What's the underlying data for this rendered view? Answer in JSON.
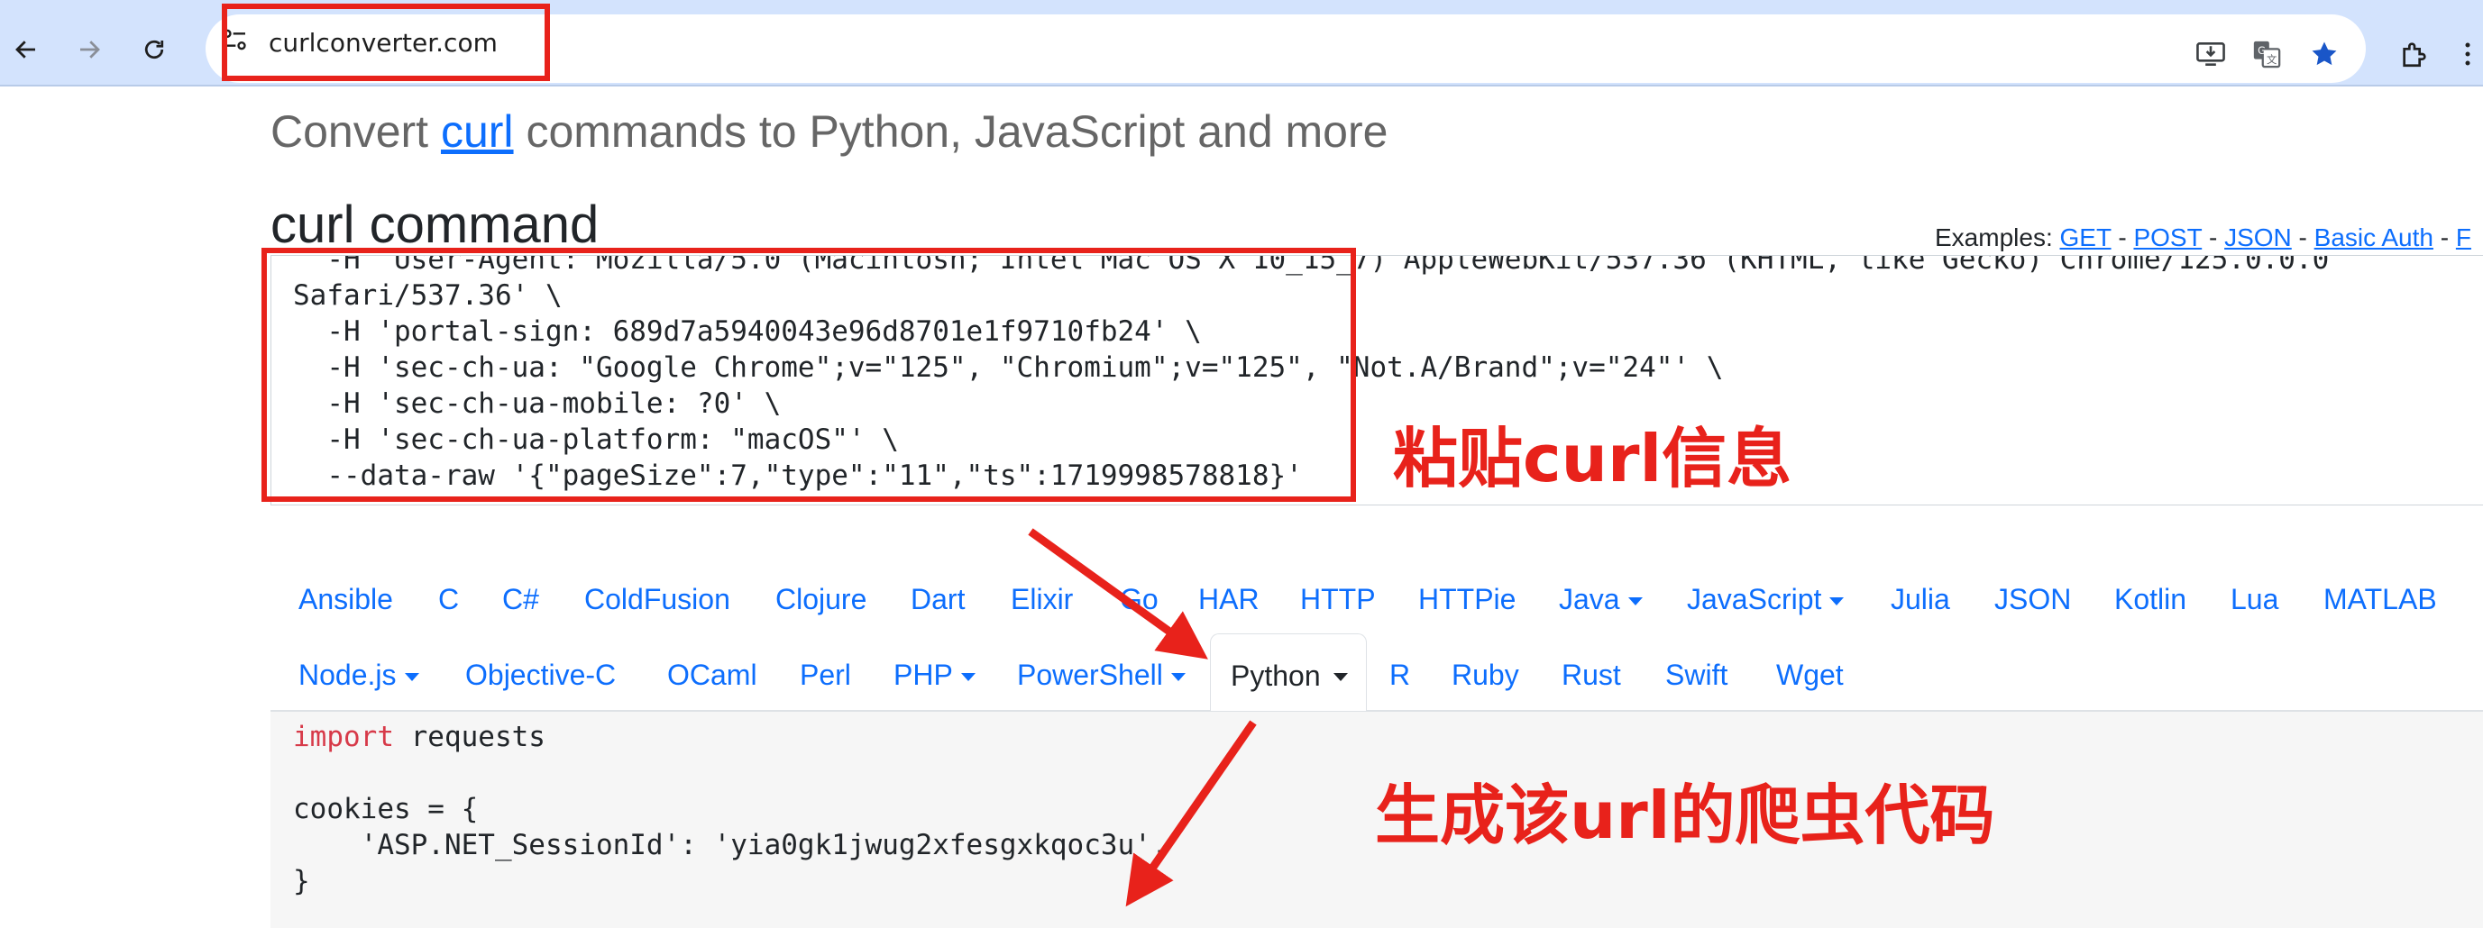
{
  "browser": {
    "url": "curlconverter.com",
    "icons": {
      "back": "back-arrow-icon",
      "forward": "forward-arrow-icon",
      "reload": "reload-icon",
      "site_info": "tune-icon",
      "install": "install-app-icon",
      "translate": "translate-icon",
      "bookmark": "star-icon",
      "extensions": "puzzle-icon"
    }
  },
  "page": {
    "title_prefix": "Convert ",
    "title_link": "curl",
    "title_suffix": " commands to Python, JavaScript and more",
    "curl_heading": "curl command",
    "examples_label": "Examples: ",
    "examples": [
      "GET",
      "POST",
      "JSON",
      "Basic Auth",
      "F"
    ],
    "examples_separator": " - "
  },
  "curl_input": {
    "lines": [
      "  -H 'User-Agent: Mozilla/5.0 (Macintosh; Intel Mac OS X 10_15_7) AppleWebKit/537.36 (KHTML, like Gecko) Chrome/125.0.0.0",
      "Safari/537.36' \\",
      "  -H 'portal-sign: 689d7a5940043e96d8701e1f9710fb24' \\",
      "  -H 'sec-ch-ua: \"Google Chrome\";v=\"125\", \"Chromium\";v=\"125\", \"Not.A/Brand\";v=\"24\"' \\",
      "  -H 'sec-ch-ua-mobile: ?0' \\",
      "  -H 'sec-ch-ua-platform: \"macOS\"' \\",
      "  --data-raw '{\"pageSize\":7,\"type\":\"11\",\"ts\":1719998578818}'"
    ]
  },
  "languages": {
    "row1": [
      {
        "label": "Ansible",
        "dropdown": false
      },
      {
        "label": "C",
        "dropdown": false
      },
      {
        "label": "C#",
        "dropdown": false
      },
      {
        "label": "ColdFusion",
        "dropdown": false
      },
      {
        "label": "Clojure",
        "dropdown": false
      },
      {
        "label": "Dart",
        "dropdown": false
      },
      {
        "label": "Elixir",
        "dropdown": false
      },
      {
        "label": "Go",
        "dropdown": false
      },
      {
        "label": "HAR",
        "dropdown": false
      },
      {
        "label": "HTTP",
        "dropdown": false
      },
      {
        "label": "HTTPie",
        "dropdown": false
      },
      {
        "label": "Java",
        "dropdown": true
      },
      {
        "label": "JavaScript",
        "dropdown": true
      },
      {
        "label": "Julia",
        "dropdown": false
      },
      {
        "label": "JSON",
        "dropdown": false
      },
      {
        "label": "Kotlin",
        "dropdown": false
      },
      {
        "label": "Lua",
        "dropdown": false
      },
      {
        "label": "MATLAB",
        "dropdown": false
      }
    ],
    "row2": [
      {
        "label": "Node.js",
        "dropdown": true
      },
      {
        "label": "Objective-C",
        "dropdown": false
      },
      {
        "label": "OCaml",
        "dropdown": false
      },
      {
        "label": "Perl",
        "dropdown": false
      },
      {
        "label": "PHP",
        "dropdown": true
      },
      {
        "label": "PowerShell",
        "dropdown": true
      },
      {
        "label": "Python",
        "dropdown": true,
        "active": true
      },
      {
        "label": "R",
        "dropdown": false
      },
      {
        "label": "Ruby",
        "dropdown": false
      },
      {
        "label": "Rust",
        "dropdown": false
      },
      {
        "label": "Swift",
        "dropdown": false
      },
      {
        "label": "Wget",
        "dropdown": false
      }
    ]
  },
  "output_code": {
    "keyword": "import",
    "import_rest": " requests",
    "line_cookies": "cookies = {",
    "line_session": "    'ASP.NET_SessionId': 'yia0gk1jwug2xfesgxkqoc3u',",
    "line_close": "}"
  },
  "annotations": {
    "paste_label": "粘贴curl信息",
    "generate_label": "生成该url的爬虫代码",
    "color": "#e8221b"
  }
}
